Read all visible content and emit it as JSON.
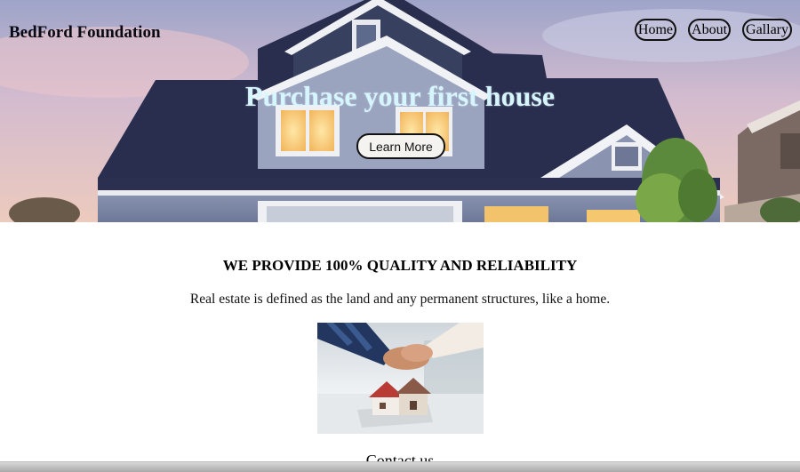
{
  "header": {
    "brand": "BedFord Foundation",
    "nav": [
      {
        "label": "Home"
      },
      {
        "label": "About"
      },
      {
        "label": "Gallary"
      }
    ]
  },
  "hero": {
    "title": "Purchase your first house",
    "cta_label": "Learn More"
  },
  "section": {
    "heading": "WE PROVIDE 100% QUALITY AND RELIABILITY",
    "text": "Real estate is defined as the land and any permanent structures, like a home.",
    "next_heading": "Contact us"
  }
}
